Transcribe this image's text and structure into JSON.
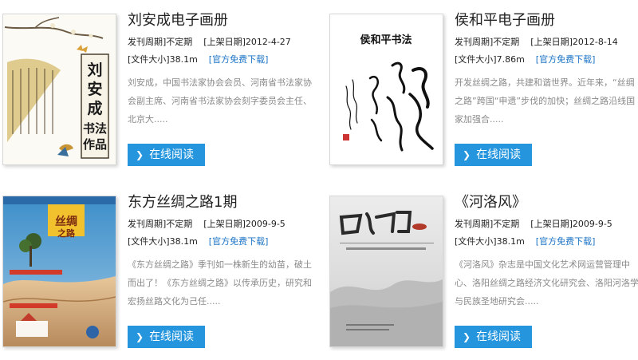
{
  "cards": [
    {
      "title": "刘安成电子画册",
      "period_label": "发刊周期]不定期",
      "date_label": "[上架日期]2012-4-27",
      "size_label": "[文件大小]38.1m",
      "download_label": "[官方免费下载]",
      "description": "刘安成，中国书法家协会会员、河南省书法家协会副主席、河南省书法家协会刻字委员会主任、北京大.....",
      "read_label": "在线阅读",
      "cover_text": "刘安成书法作品"
    },
    {
      "title": "侯和平电子画册",
      "period_label": "发刊周期]不定期",
      "date_label": "[上架日期]2012-8-14",
      "size_label": "[文件大小]7.86m",
      "download_label": "[官方免费下载]",
      "description": "开发丝绸之路，共建和谐世界。近年来，“丝绸之路”跨国“申遗”步伐的加快；丝绸之路沿线国家加强合.....",
      "read_label": "在线阅读",
      "cover_text": "侯和平书法"
    },
    {
      "title": "东方丝绸之路1期",
      "period_label": "发刊周期]不定期",
      "date_label": "[上架日期]2009-9-5",
      "size_label": "[文件大小]38.1m",
      "download_label": "[官方免费下载]",
      "description": "《东方丝绸之路》季刊如一株新生的幼苗，破土而出了！《东方丝绸之路》以传承历史，研究和宏扬丝路文化为己任.....",
      "read_label": "在线阅读",
      "cover_text": "丝绸之路"
    },
    {
      "title": "《河洛风》",
      "period_label": "发刊周期]不定期",
      "date_label": "[上架日期]2009-9-5",
      "size_label": "[文件大小]38.1m",
      "download_label": "[官方免费下载]",
      "description": "《河洛风》杂志是中国文化艺术网运营管理中心、洛阳丝绸之路经济文化研究会、洛阳河洛学与民族圣地研究会.....",
      "read_label": "在线阅读",
      "cover_text": "河洛风"
    }
  ],
  "colors": {
    "button_bg": "#2596de",
    "link": "#1a73c6",
    "description_text": "#8a8a8a"
  },
  "icons": {
    "read_button": "chevron-right-icon"
  }
}
